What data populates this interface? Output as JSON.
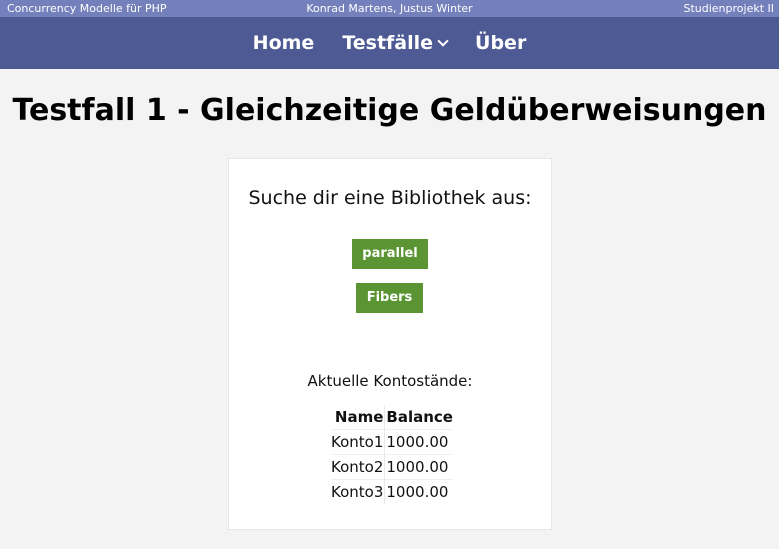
{
  "topbar": {
    "left": "Concurrency Modelle für PHP",
    "center": "Konrad Martens, Justus Winter",
    "right": "Studienprojekt II"
  },
  "nav": {
    "home": "Home",
    "testfaelle": "Testfälle",
    "ueber": "Über"
  },
  "page_title": "Testfall 1 - Gleichzeitige Geldüberweisungen",
  "card": {
    "heading": "Suche dir eine Bibliothek aus:",
    "buttons": [
      "parallel",
      "Fibers"
    ],
    "balances_label": "Aktuelle Kontostände:",
    "table": {
      "headers": [
        "Name",
        "Balance"
      ],
      "rows": [
        [
          "Konto1",
          "1000.00"
        ],
        [
          "Konto2",
          "1000.00"
        ],
        [
          "Konto3",
          "1000.00"
        ]
      ]
    }
  },
  "colors": {
    "topbar": "#7480bb",
    "navbar": "#4e5a94",
    "button": "#5b9533",
    "background": "#f3f3f4"
  }
}
